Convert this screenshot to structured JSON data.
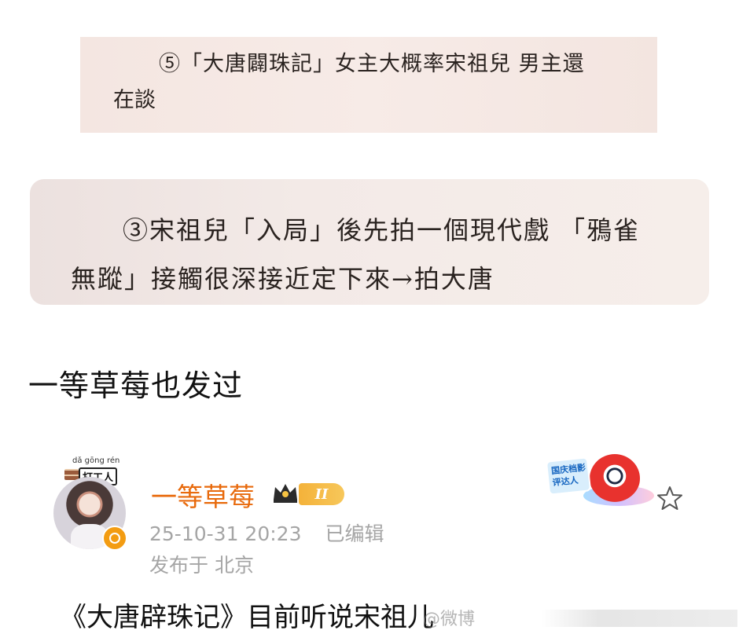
{
  "excerpt_1": {
    "line1": "⑤「大唐闢珠記」女主大概率宋祖兒 男主還",
    "line2": "在談"
  },
  "excerpt_2": {
    "line1": "③宋祖兒「入局」後先拍一個現代戲 「鴉雀",
    "line2": "無蹤」接觸很深接近定下來→拍大唐"
  },
  "caption": "一等草莓也发过",
  "post": {
    "avatar_tag_pinyin": "dǎ gōng rén",
    "avatar_tag_label": "打工人",
    "username": "一等草莓",
    "level": "II",
    "timestamp": "25-10-31 20:23",
    "edited_label": "已编辑",
    "location": "发布于 北京",
    "award_badge_text": "国庆档影评达人",
    "text": "《大唐辟珠记》目前听说宋祖儿"
  },
  "watermark": {
    "text": "@微博"
  },
  "colors": {
    "username": "#e86a0c",
    "meta_gray": "#a5a5a5",
    "level_badge": "#f4b23a",
    "verify_badge": "#f39c12"
  }
}
